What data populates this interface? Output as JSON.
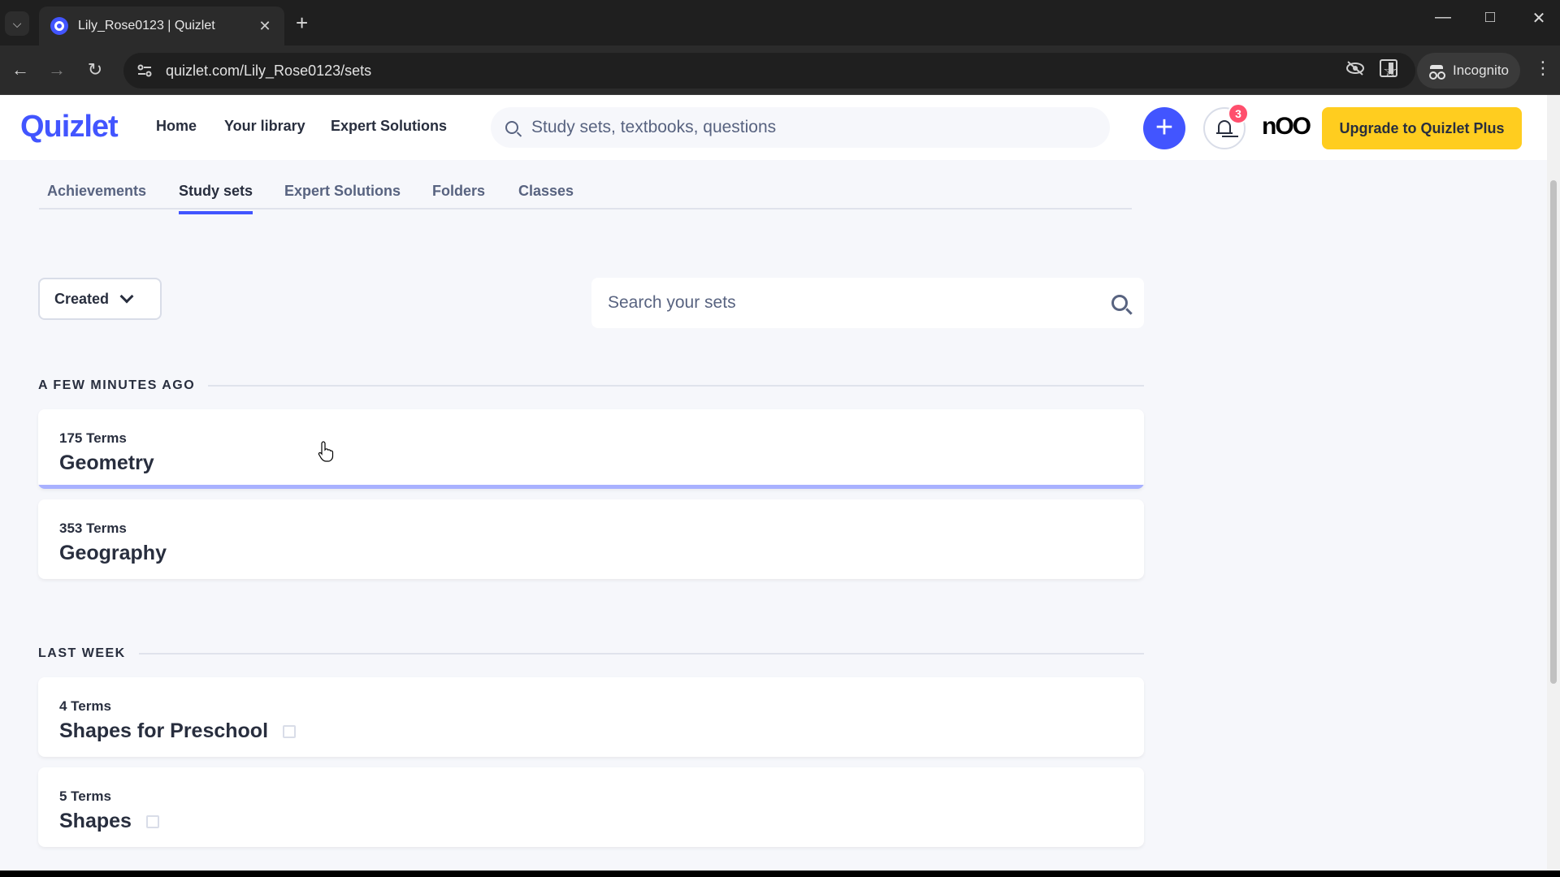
{
  "browser": {
    "tab_title": "Lily_Rose0123 | Quizlet",
    "url": "quizlet.com/Lily_Rose0123/sets",
    "incognito_label": "Incognito"
  },
  "header": {
    "logo": "Quizlet",
    "nav": [
      "Home",
      "Your library",
      "Expert Solutions"
    ],
    "search_placeholder": "Study sets, textbooks, questions",
    "notification_count": "3",
    "avatar_text": "nOO",
    "upgrade_label": "Upgrade to Quizlet Plus"
  },
  "subtabs": [
    "Achievements",
    "Study sets",
    "Expert Solutions",
    "Folders",
    "Classes"
  ],
  "active_subtab": "Study sets",
  "filter": {
    "selected": "Created"
  },
  "set_search": {
    "placeholder": "Search your sets"
  },
  "sections": [
    {
      "title": "A FEW MINUTES AGO",
      "sets": [
        {
          "count": "175 Terms",
          "title": "Geometry"
        },
        {
          "count": "353 Terms",
          "title": "Geography"
        }
      ]
    },
    {
      "title": "LAST WEEK",
      "sets": [
        {
          "count": "4 Terms",
          "title": "Shapes for Preschool"
        },
        {
          "count": "5 Terms",
          "title": "Shapes"
        }
      ]
    }
  ],
  "colors": {
    "brand": "#4255ff",
    "upgrade": "#ffcd1f",
    "badge": "#ff4f6d"
  }
}
